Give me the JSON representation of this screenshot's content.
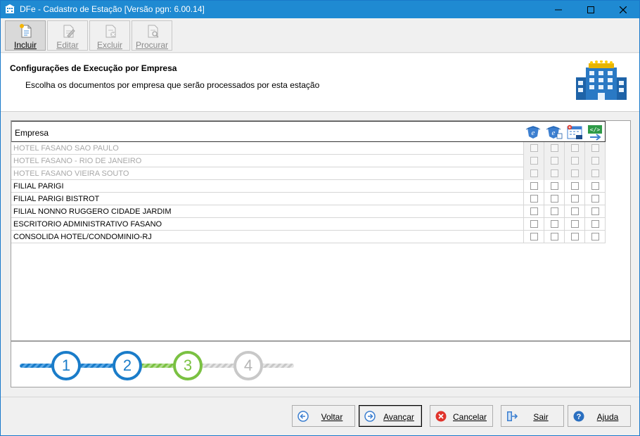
{
  "window": {
    "title": "DFe - Cadastro de Estação [Versão pgn: 6.00.14]"
  },
  "toolbar": {
    "incluir": "Incluir",
    "editar": "Editar",
    "excluir": "Excluir",
    "procurar": "Procurar"
  },
  "header": {
    "title": "Configurações de Execução por Empresa",
    "subtitle": "Escolha os documentos por empresa que serão processados por esta estação"
  },
  "grid": {
    "column_empresa": "Empresa",
    "column_icons": [
      "nfe-icon",
      "nfce-icon",
      "cte-icon",
      "xml-download-icon"
    ],
    "rows": [
      {
        "name": "HOTEL FASANO SAO PAULO",
        "disabled": true
      },
      {
        "name": "HOTEL FASANO - RIO DE JANEIRO",
        "disabled": true
      },
      {
        "name": "HOTEL FASANO VIEIRA SOUTO",
        "disabled": true
      },
      {
        "name": "FILIAL PARIGI",
        "disabled": false
      },
      {
        "name": "FILIAL PARIGI BISTROT",
        "disabled": false
      },
      {
        "name": "FILIAL NONNO RUGGERO CIDADE JARDIM",
        "disabled": false
      },
      {
        "name": "ESCRITORIO ADMINISTRATIVO FASANO",
        "disabled": false
      },
      {
        "name": "CONSOLIDA HOTEL/CONDOMINIO-RJ",
        "disabled": false
      }
    ]
  },
  "stepper": {
    "steps": [
      "1",
      "2",
      "3",
      "4"
    ],
    "current_step": 3,
    "colors": {
      "done": "#1a7cc9",
      "current": "#7ac142",
      "pending": "#c8c8c8"
    }
  },
  "buttons": {
    "voltar": "Voltar",
    "avancar": "Avançar",
    "cancelar": "Cancelar",
    "sair": "Sair",
    "ajuda": "Ajuda"
  }
}
